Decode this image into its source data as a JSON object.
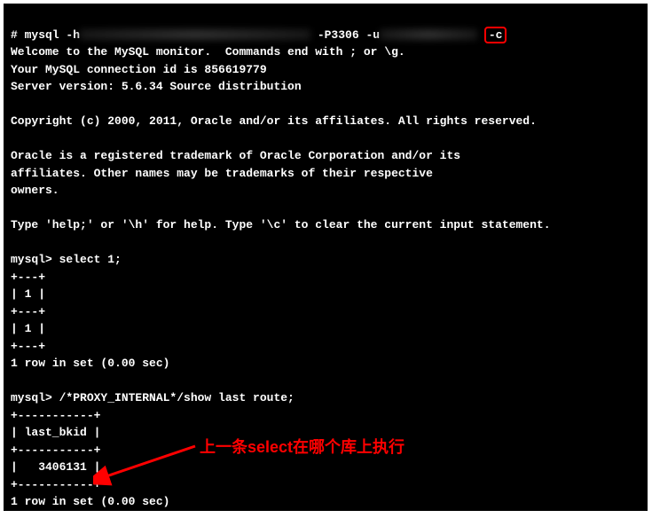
{
  "terminal": {
    "prompt_line": {
      "prompt": "# ",
      "cmd_start": "mysql -h",
      "port": " -P3306 -u",
      "flag": "-c"
    },
    "welcome1": "Welcome to the MySQL monitor.  Commands end with ; or \\g.",
    "welcome2": "Your MySQL connection id is 856619779",
    "welcome3": "Server version: 5.6.34 Source distribution",
    "copyright": "Copyright (c) 2000, 2011, Oracle and/or its affiliates. All rights reserved.",
    "trademark1": "Oracle is a registered trademark of Oracle Corporation and/or its",
    "trademark2": "affiliates. Other names may be trademarks of their respective",
    "trademark3": "owners.",
    "help": "Type 'help;' or '\\h' for help. Type '\\c' to clear the current input statement.",
    "query1_prompt": "mysql> ",
    "query1_cmd": "select 1;",
    "query1_sep": "+---+",
    "query1_header": "| 1 |",
    "query1_value": "| 1 |",
    "query1_result": "1 row in set (0.00 sec)",
    "query2_prompt": "mysql> ",
    "query2_cmd": "/*PROXY_INTERNAL*/show last route;",
    "query2_sep": "+-----------+",
    "query2_header": "| last_bkid |",
    "query2_value": "|   3406131 |",
    "query2_result": "1 row in set (0.00 sec)"
  },
  "annotation": {
    "text": "上一条select在哪个库上执行"
  }
}
